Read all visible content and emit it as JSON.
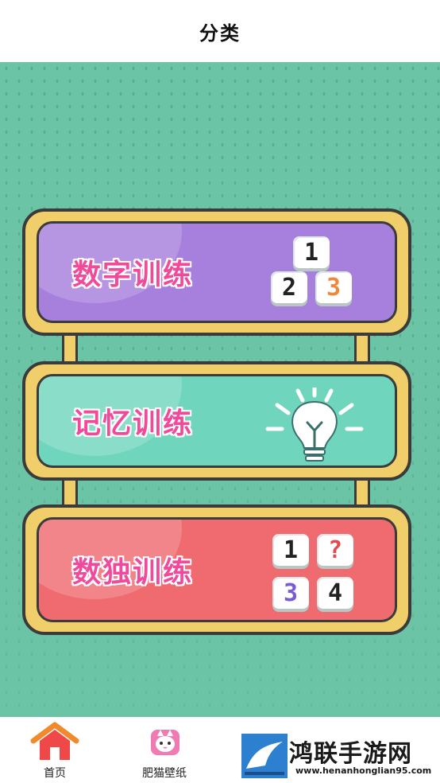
{
  "header": {
    "title": "分类"
  },
  "categories": [
    {
      "label": "数字训练",
      "tiles": [
        "1",
        "2",
        "3"
      ]
    },
    {
      "label": "记忆训练",
      "icon": "lightbulb-icon"
    },
    {
      "label": "数独训练",
      "tiles": [
        "1",
        "?",
        "3",
        "4"
      ]
    }
  ],
  "tabbar": {
    "items": [
      {
        "label": "首页",
        "icon": "home-icon"
      },
      {
        "label": "肥猫壁纸",
        "icon": "cat-icon"
      }
    ]
  },
  "watermark": {
    "text": "鸿联手游网",
    "url": "www.henanhonglian95.com"
  },
  "colors": {
    "background": "#6cc4a6",
    "frame": "#f0cf6a",
    "card1": "#a77fdc",
    "card2": "#6fd6bd",
    "card3": "#ef6b70",
    "label": "#f24a9a"
  }
}
